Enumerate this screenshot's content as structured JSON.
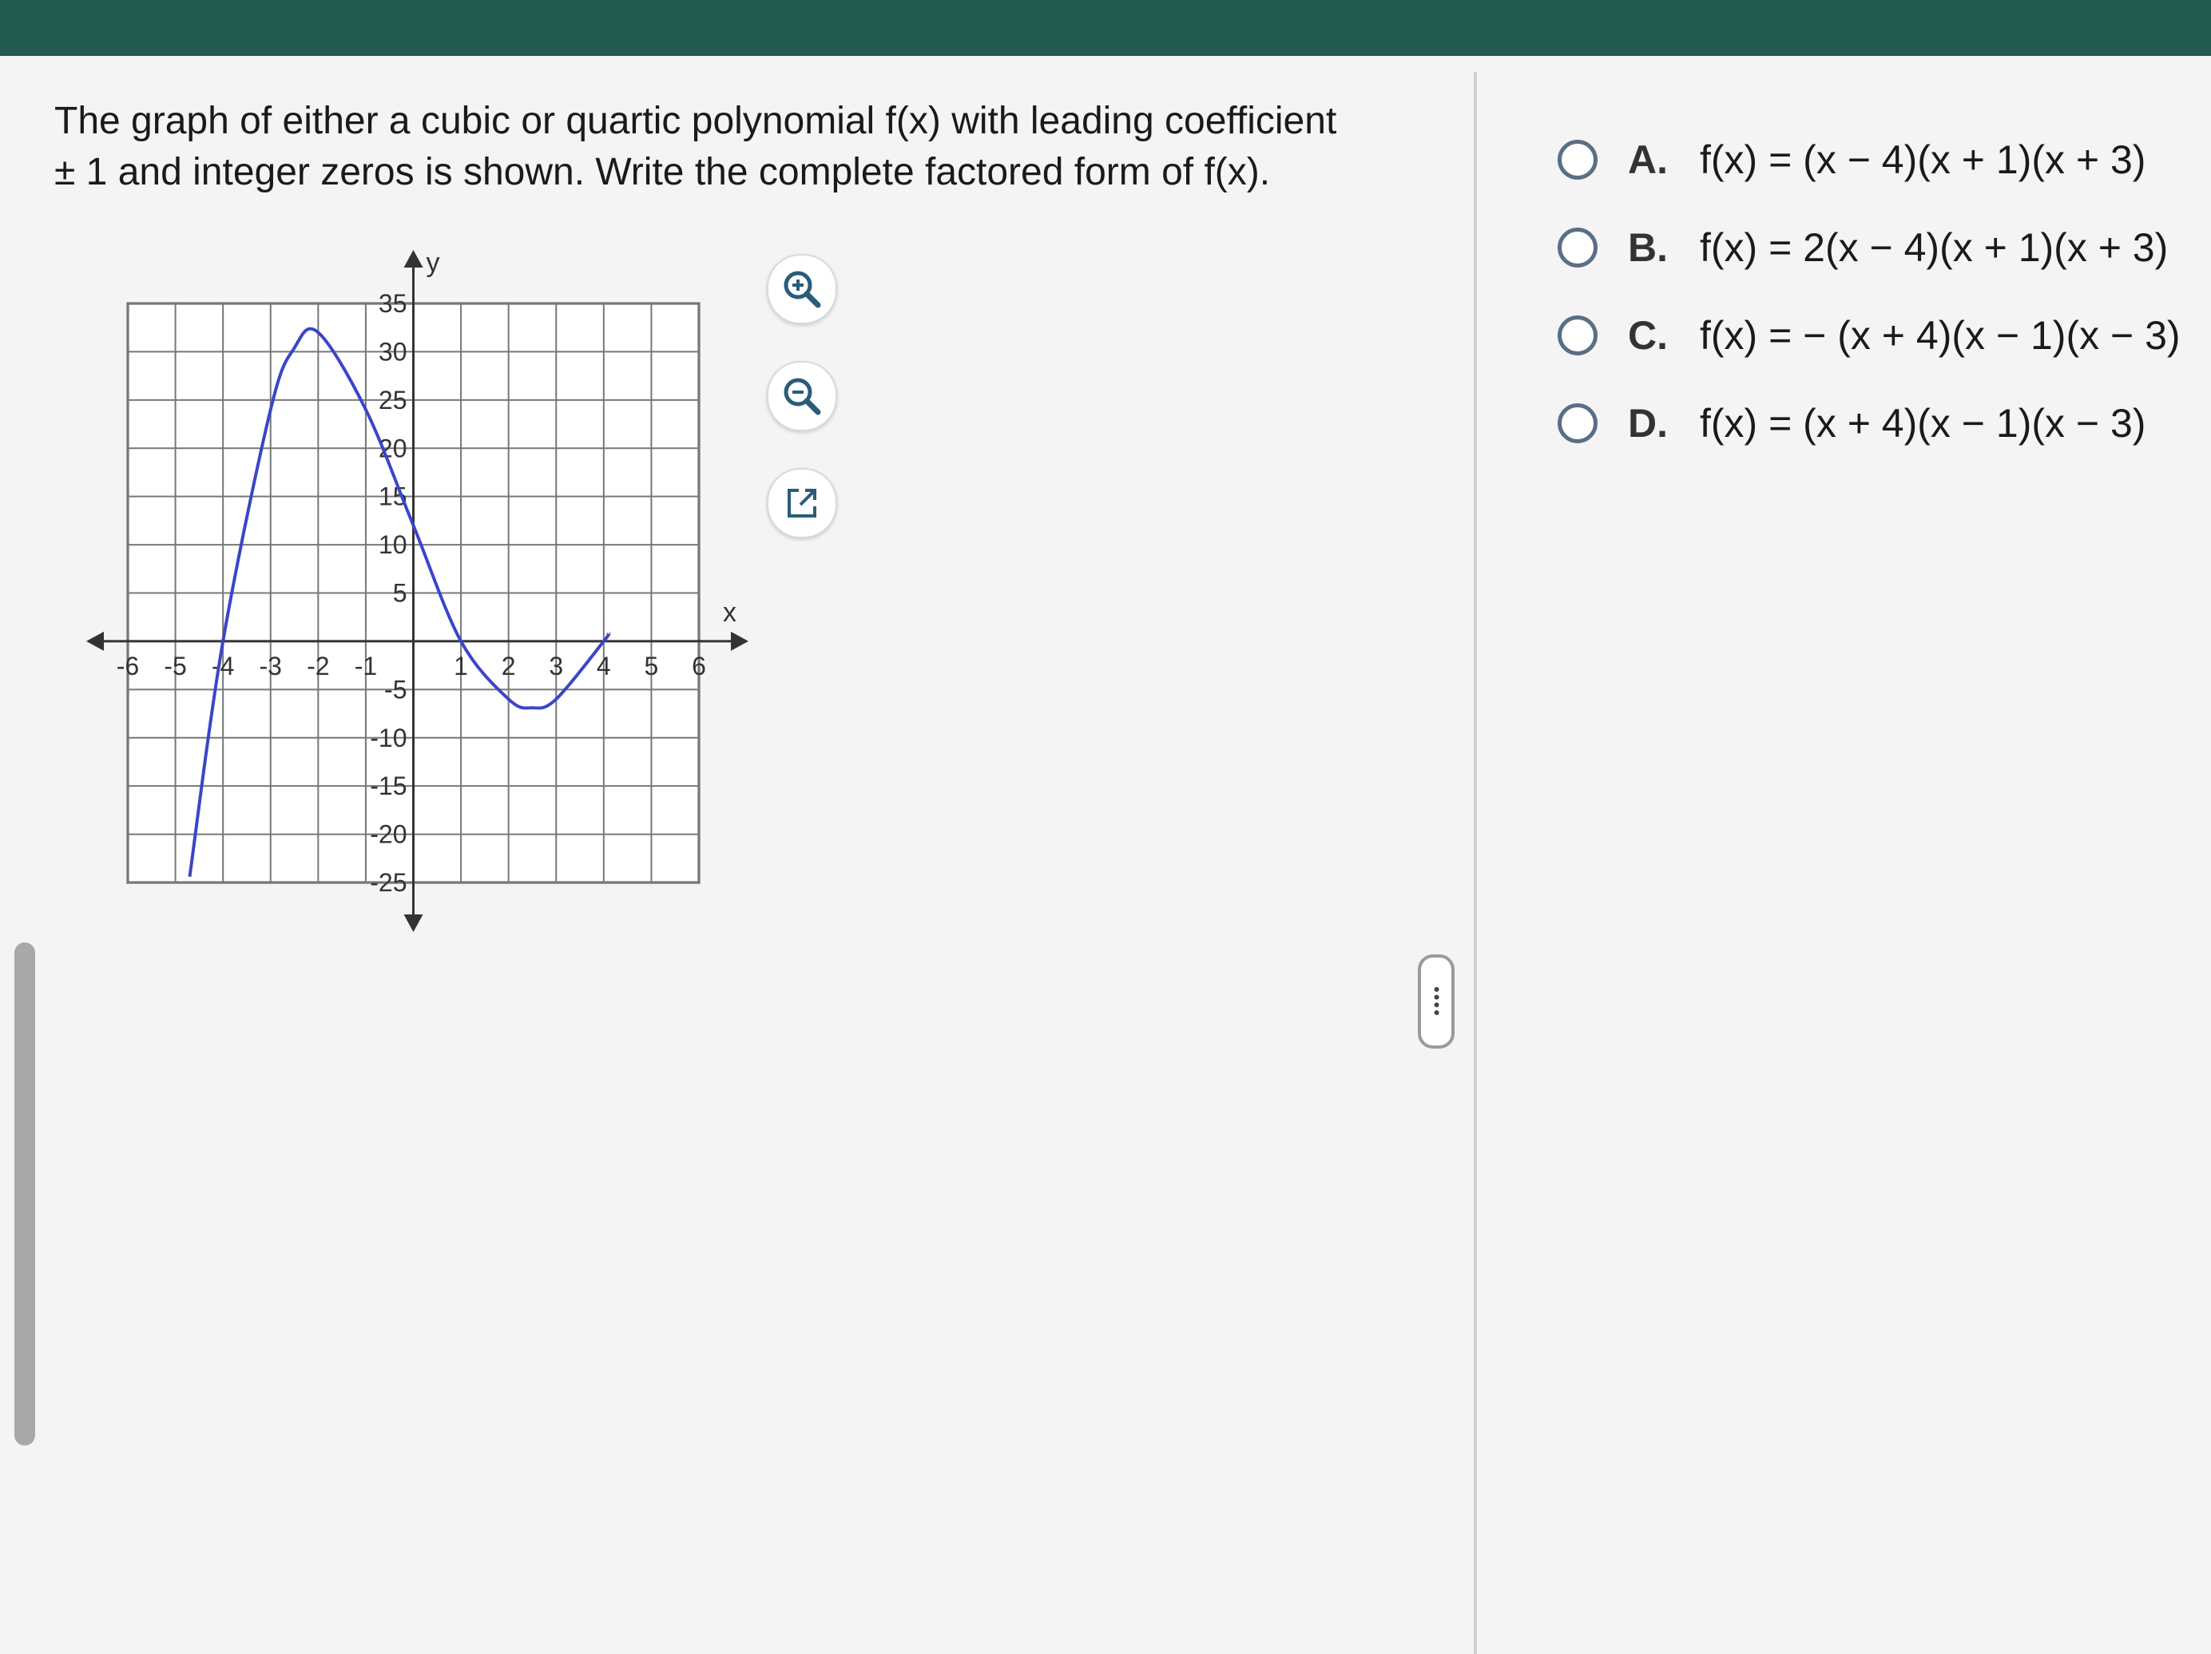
{
  "question": {
    "line1": "The graph of either a cubic or quartic polynomial f(x) with leading coefficient",
    "line2": "± 1 and integer zeros is shown. Write the complete factored form of f(x)."
  },
  "graph": {
    "x_axis_label": "x",
    "y_axis_label": "y",
    "x_tick_labels": [
      "-6",
      "-5",
      "-4",
      "-3",
      "-2",
      "-1",
      "1",
      "2",
      "3",
      "4",
      "5",
      "6"
    ],
    "y_tick_labels_positive": [
      "35",
      "30",
      "25",
      "20",
      "15",
      "10",
      "5"
    ],
    "y_tick_labels_negative": [
      "-5",
      "-10",
      "-15",
      "-20",
      "-25"
    ],
    "curve_color": "#3a46c8"
  },
  "chart_data": {
    "type": "line",
    "title": "",
    "xlabel": "x",
    "ylabel": "y",
    "xlim": [
      -6,
      6
    ],
    "ylim": [
      -25,
      35
    ],
    "grid": true,
    "x_ticks": [
      -6,
      -5,
      -4,
      -3,
      -2,
      -1,
      1,
      2,
      3,
      4,
      5,
      6
    ],
    "y_ticks": [
      -25,
      -20,
      -15,
      -10,
      -5,
      5,
      10,
      15,
      20,
      25,
      30,
      35
    ],
    "series": [
      {
        "x": [
          -4.7,
          -4,
          -3,
          -2.5,
          -2,
          -1,
          0,
          1,
          2,
          2.5,
          3,
          4,
          4.1
        ],
        "y": [
          -24.4,
          0,
          24,
          30.4,
          32,
          24,
          12,
          0,
          -6,
          -6.9,
          -6,
          0,
          0.8
        ]
      }
    ]
  },
  "tools": {
    "zoom_in": "zoom-in-icon",
    "zoom_out": "zoom-out-icon",
    "popout": "popout-icon"
  },
  "answers": [
    {
      "letter": "A.",
      "expr": "f(x) = (x − 4)(x + 1)(x + 3)"
    },
    {
      "letter": "B.",
      "expr": "f(x) = 2(x − 4)(x + 1)(x + 3)"
    },
    {
      "letter": "C.",
      "expr": "f(x) = − (x + 4)(x − 1)(x − 3)"
    },
    {
      "letter": "D.",
      "expr": "f(x) = (x + 4)(x − 1)(x − 3)"
    }
  ],
  "colors": {
    "topbar": "#235a52",
    "radio_border": "#5a6e86",
    "curve": "#3a46c8"
  }
}
